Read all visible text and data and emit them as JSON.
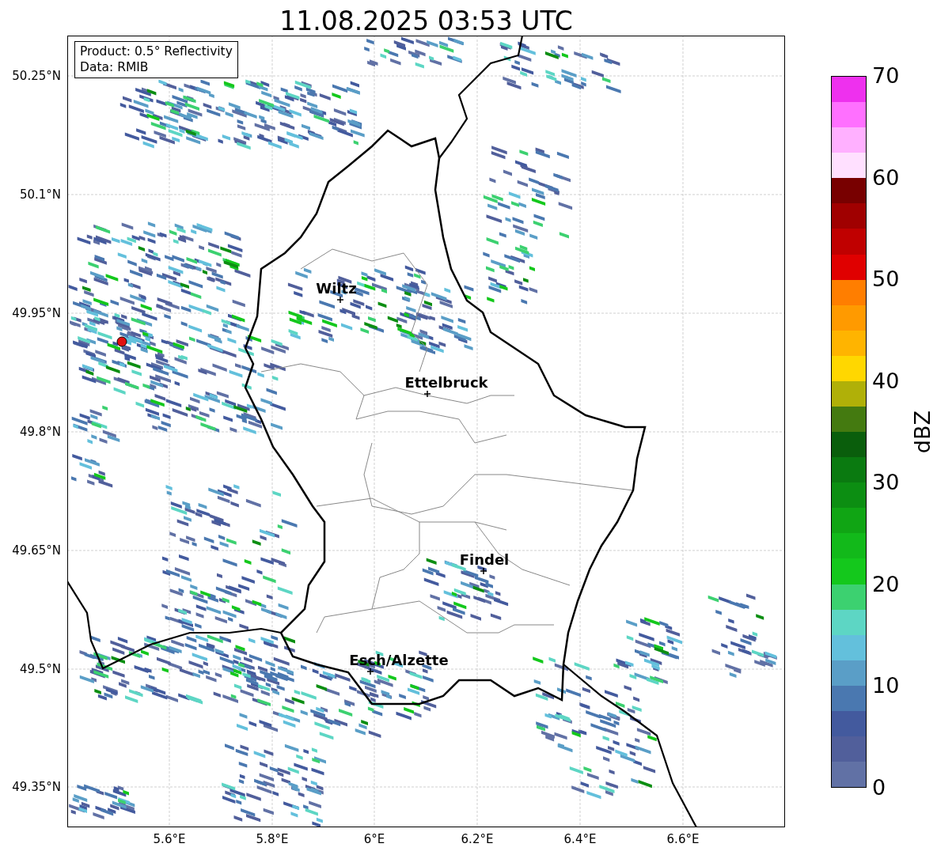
{
  "title": "11.08.2025 03:53 UTC",
  "info_box": {
    "lines": [
      "Product: 0.5° Reflectivity",
      "Data: RMIB"
    ]
  },
  "map": {
    "cities": [
      {
        "name": "Wiltz"
      },
      {
        "name": "Ettelbruck"
      },
      {
        "name": "Findel"
      },
      {
        "name": "Esch/Alzette"
      }
    ],
    "yticks": [
      "50.25°N",
      "50.1°N",
      "49.95°N",
      "49.8°N",
      "49.65°N",
      "49.5°N",
      "49.35°N"
    ],
    "xticks": [
      "5.6°E",
      "5.8°E",
      "6°E",
      "6.2°E",
      "6.4°E",
      "6.6°E"
    ]
  },
  "colorbar": {
    "label": "dBZ",
    "ticks": [
      "70",
      "60",
      "50",
      "40",
      "30",
      "20",
      "10",
      "0"
    ],
    "segments": [
      {
        "color": "#ee30ee"
      },
      {
        "color": "#ff70ff"
      },
      {
        "color": "#ffb0ff"
      },
      {
        "color": "#ffe0ff"
      },
      {
        "color": "#780000"
      },
      {
        "color": "#a00000"
      },
      {
        "color": "#c00000"
      },
      {
        "color": "#e00000"
      },
      {
        "color": "#ff7e00"
      },
      {
        "color": "#ff9a00"
      },
      {
        "color": "#ffb400"
      },
      {
        "color": "#ffd700"
      },
      {
        "color": "#b0b008"
      },
      {
        "color": "#447a10"
      },
      {
        "color": "#0a5e0c"
      },
      {
        "color": "#0a7a10"
      },
      {
        "color": "#0c8e12"
      },
      {
        "color": "#10a514"
      },
      {
        "color": "#12b91a"
      },
      {
        "color": "#14c81c"
      },
      {
        "color": "#3cd170"
      },
      {
        "color": "#5dd6c4"
      },
      {
        "color": "#63c0dc"
      },
      {
        "color": "#5a9ec7"
      },
      {
        "color": "#4a78b0"
      },
      {
        "color": "#435a9e"
      },
      {
        "color": "#515f9b"
      },
      {
        "color": "#6171a5"
      }
    ]
  }
}
